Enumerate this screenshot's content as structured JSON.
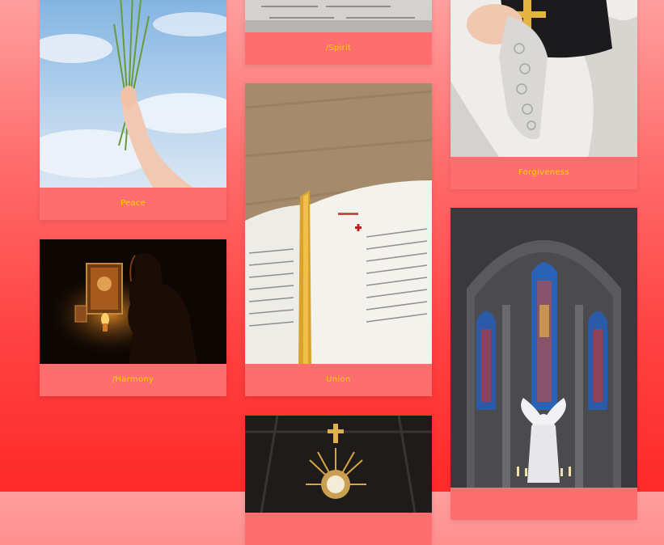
{
  "gallery": {
    "colors": {
      "caption_text": "#ffd400",
      "card_background": "#ff6e6e"
    },
    "cards": [
      {
        "caption": "Peace",
        "image": "hand-holding-palm-leaves-photo"
      },
      {
        "caption": "/Harmony",
        "image": "woman-praying-by-candlelight-photo"
      },
      {
        "caption": "/Spirit",
        "image": "open-book-photo"
      },
      {
        "caption": "Union",
        "image": "open-bible-with-ribbon-photo"
      },
      {
        "caption": "",
        "image": "golden-monstrance-photo"
      },
      {
        "caption": "Forgiveness",
        "image": "priest-holding-bible-photo"
      },
      {
        "caption": "",
        "image": "church-stained-glass-windows-photo"
      }
    ]
  }
}
